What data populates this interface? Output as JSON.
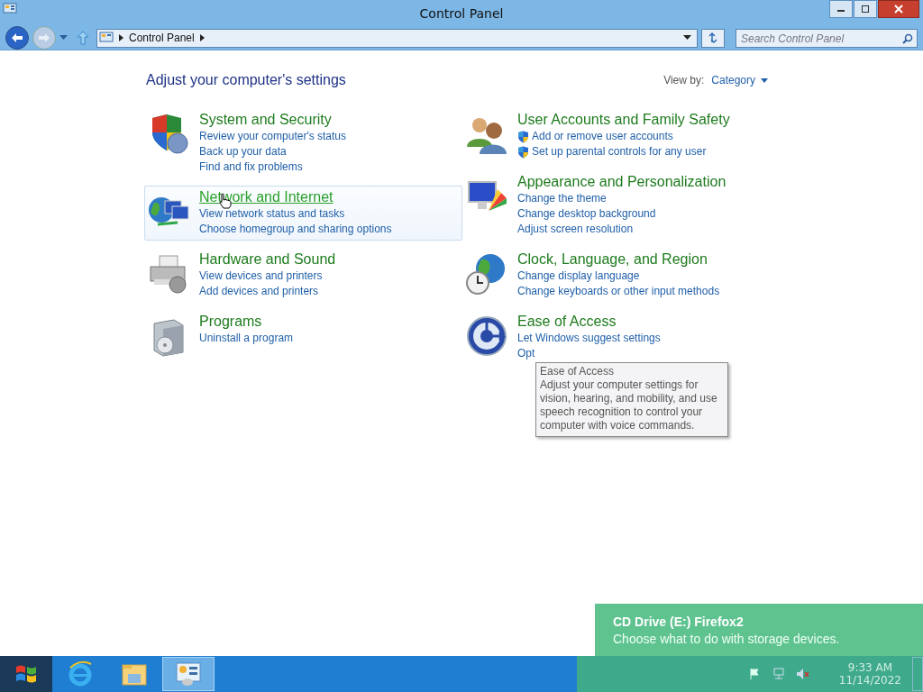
{
  "window": {
    "title": "Control Panel"
  },
  "address_bar": {
    "path": [
      "Control Panel"
    ]
  },
  "search": {
    "placeholder": "Search Control Panel"
  },
  "heading": "Adjust your computer's settings",
  "view_by": {
    "label": "View by:",
    "value": "Category"
  },
  "columns": [
    {
      "categories": [
        {
          "title": "System and Security",
          "hovered": false,
          "links": [
            {
              "text": "Review your computer's status",
              "shield": false
            },
            {
              "text": "Back up your data",
              "shield": false
            },
            {
              "text": "Find and fix problems",
              "shield": false
            }
          ]
        },
        {
          "title": "Network and Internet",
          "hovered": true,
          "links": [
            {
              "text": "View network status and tasks",
              "shield": false
            },
            {
              "text": "Choose homegroup and sharing options",
              "shield": false
            }
          ]
        },
        {
          "title": "Hardware and Sound",
          "hovered": false,
          "links": [
            {
              "text": "View devices and printers",
              "shield": false
            },
            {
              "text": "Add devices and printers",
              "shield": false
            }
          ]
        },
        {
          "title": "Programs",
          "hovered": false,
          "links": [
            {
              "text": "Uninstall a program",
              "shield": false
            }
          ]
        }
      ]
    },
    {
      "categories": [
        {
          "title": "User Accounts and Family Safety",
          "hovered": false,
          "links": [
            {
              "text": "Add or remove user accounts",
              "shield": true
            },
            {
              "text": "Set up parental controls for any user",
              "shield": true
            }
          ]
        },
        {
          "title": "Appearance and Personalization",
          "hovered": false,
          "links": [
            {
              "text": "Change the theme",
              "shield": false
            },
            {
              "text": "Change desktop background",
              "shield": false
            },
            {
              "text": "Adjust screen resolution",
              "shield": false
            }
          ]
        },
        {
          "title": "Clock, Language, and Region",
          "hovered": false,
          "links": [
            {
              "text": "Change display language",
              "shield": false
            },
            {
              "text": "Change keyboards or other input methods",
              "shield": false
            }
          ]
        },
        {
          "title": "Ease of Access",
          "hovered": false,
          "links": [
            {
              "text": "Let Windows suggest settings",
              "shield": false
            },
            {
              "text": "Opt",
              "shield": false
            }
          ]
        }
      ]
    }
  ],
  "tooltip": {
    "title": "Ease of Access",
    "text": "Adjust your computer settings for vision, hearing, and mobility, and use speech recognition to control your computer with voice commands."
  },
  "notification": {
    "title": "CD Drive (E:) Firefox2",
    "message": "Choose what to do with storage devices."
  },
  "taskbar": {
    "apps": [
      {
        "selected": false
      },
      {
        "selected": false
      },
      {
        "selected": true
      }
    ],
    "clock": {
      "time": "9:33 AM",
      "date": "11/14/2022"
    }
  }
}
